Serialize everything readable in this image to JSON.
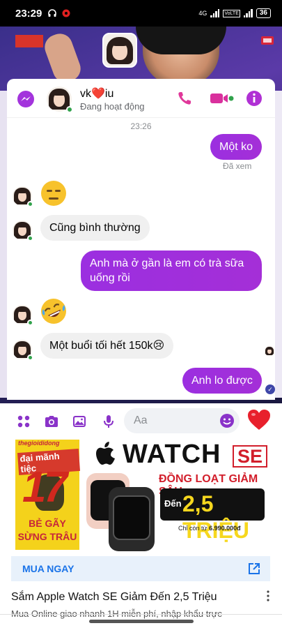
{
  "status_bar": {
    "time": "23:29",
    "network": "4G",
    "battery": "36",
    "volte": "VoLTE"
  },
  "chat": {
    "contact_name": "vk❤️iu",
    "contact_status": "Đang hoạt động",
    "timestamp": "23:26",
    "messages": [
      {
        "from": "me",
        "text": "Một ko"
      },
      {
        "from": "them",
        "emoji": "expressionless-face"
      },
      {
        "from": "them",
        "text": "Cũng bình thường"
      },
      {
        "from": "me",
        "text": "Anh mà ở gần là em có trà sữa uống rồi"
      },
      {
        "from": "them",
        "emoji": "rolling-laughing-face"
      },
      {
        "from": "them",
        "text": "Một buổi tối hết 150k😢"
      },
      {
        "from": "me",
        "text": "Anh lo được"
      }
    ],
    "seen_label": "Đã xem"
  },
  "composer": {
    "placeholder": "Aa"
  },
  "ad": {
    "brand_tag": "thegioididong",
    "sale_tag": "đại mãnh tiệc",
    "big_number": "17",
    "tagline_1": "BẺ GÃY",
    "tagline_2": "SỪNG TRÂU",
    "product_word": "WATCH",
    "product_model": "SE",
    "deal_text": "ĐỒNG LOẠT GIẢM SÂU",
    "price_prefix": "Đến",
    "price": "2,5 TRIỆU",
    "from_price_label": "Chỉ còn từ",
    "from_price": "6.990.000đ",
    "cta": "MUA NGAY",
    "title": "Sắm Apple Watch SE Giảm Đến 2,5 Triệu",
    "description": "Mua Online giao nhanh 1H miễn phí, nhập khẩu trực"
  },
  "colors": {
    "messenger_purple": "#a42fd7",
    "icon_purple": "#8a33c9",
    "call_pink": "#e0389a",
    "online_green": "#31a24c"
  }
}
